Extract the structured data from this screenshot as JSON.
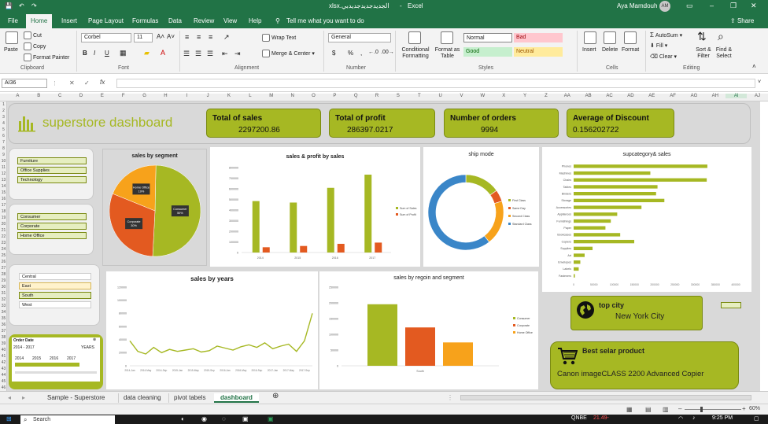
{
  "app": {
    "filename": "الجديدجديدجديدبي.xlsx",
    "app_name": "Excel",
    "user": "Aya Mamdouh",
    "user_initials": "AM"
  },
  "ribbon_tabs": [
    "File",
    "Home",
    "Insert",
    "Page Layout",
    "Formulas",
    "Data",
    "Review",
    "View",
    "Help"
  ],
  "active_tab": "Home",
  "tell_me": "Tell me what you want to do",
  "share_label": "Share",
  "clipboard": {
    "paste": "Paste",
    "cut": "Cut",
    "copy": "Copy",
    "format_painter": "Format Painter",
    "group": "Clipboard"
  },
  "font": {
    "name": "Corbel",
    "size": "11",
    "bold": "B",
    "italic": "I",
    "underline": "U",
    "group": "Font"
  },
  "alignment": {
    "wrap": "Wrap Text",
    "merge": "Merge & Center",
    "group": "Alignment"
  },
  "number": {
    "format": "General",
    "currency": "$",
    "percent": "%",
    "comma": ",",
    "group": "Number"
  },
  "styles": {
    "conditional": "Conditional Formatting",
    "format_table": "Format as Table",
    "normal": "Normal",
    "bad": "Bad",
    "good": "Good",
    "neutral": "Neutral",
    "group": "Styles"
  },
  "cells": {
    "insert": "Insert",
    "delete": "Delete",
    "format": "Format",
    "group": "Cells"
  },
  "editing": {
    "autosum": "AutoSum",
    "fill": "Fill",
    "clear": "Clear",
    "sort": "Sort & Filter",
    "find": "Find & Select",
    "group": "Editing"
  },
  "formula_bar": {
    "name_box": "AI36",
    "fx": "fx",
    "cancel": "✕",
    "enter": "✓"
  },
  "columns": [
    "A",
    "B",
    "C",
    "D",
    "E",
    "F",
    "G",
    "H",
    "I",
    "J",
    "K",
    "L",
    "M",
    "N",
    "O",
    "P",
    "Q",
    "R",
    "S",
    "T",
    "U",
    "V",
    "W",
    "X",
    "Y",
    "Z",
    "AA",
    "AB",
    "AC",
    "AD",
    "AE",
    "AF",
    "AG",
    "AH",
    "AI",
    "AJ"
  ],
  "rows": [
    "1",
    "2",
    "3",
    "4",
    "5",
    "6",
    "7",
    "8",
    "9",
    "10",
    "11",
    "12",
    "13",
    "14",
    "15",
    "16",
    "17",
    "18",
    "19",
    "20",
    "21",
    "22",
    "23",
    "24",
    "25",
    "26",
    "27",
    "28",
    "29",
    "30",
    "31",
    "32",
    "33",
    "34",
    "35",
    "36",
    "37",
    "38",
    "39",
    "40",
    "41",
    "42",
    "43",
    "44",
    "45",
    "46"
  ],
  "dashboard": {
    "title": "superstore  dashboard",
    "kpis": [
      {
        "label": "Total of sales",
        "value": "2297200.86"
      },
      {
        "label": "Total of profit",
        "value": "286397.0217"
      },
      {
        "label": "Number of orders",
        "value": "9994"
      },
      {
        "label": "Average of Discount",
        "value": "0.156202722"
      }
    ],
    "slicer_category": [
      "Furniture",
      "Office Supplies",
      "Technology"
    ],
    "slicer_segment": [
      "Consumer",
      "Corporate",
      "Home Office"
    ],
    "slicer_region": [
      "Central",
      "East",
      "South",
      "West"
    ],
    "timeline": {
      "title": "Order Date",
      "range": "2014 - 2017",
      "level": "YEARS",
      "years": [
        "2014",
        "2015",
        "2016",
        "2017"
      ]
    },
    "top_city": {
      "label": "top city",
      "value": "New York City"
    },
    "best_product": {
      "label": "Best selar product",
      "value": "Canon imageCLASS 2200 Advanced Copier"
    }
  },
  "sheet_tabs": [
    "Sample - Superstore",
    "data cleaning",
    "pivot tabels",
    "dashboard"
  ],
  "active_sheet": "dashboard",
  "status": {
    "zoom": "60%"
  },
  "taskbar": {
    "search": "Search",
    "weather": "QNBE",
    "weather_val": "21.49-",
    "time": "9:25 PM"
  },
  "colors": {
    "excel_green": "#217346",
    "olive": "#a6b823",
    "orange": "#e35a20",
    "yellow": "#f7a21b",
    "blue": "#3a86c8"
  },
  "chart_data": [
    {
      "type": "pie",
      "title": "sales by segment",
      "categories": [
        "Consumer",
        "Corporate",
        "Home Office"
      ],
      "values": [
        50,
        30,
        19
      ],
      "labels": [
        "Consumer 50%",
        "Corporate 30%",
        "Home Office 19%"
      ],
      "colors": [
        "#a6b823",
        "#e35a20",
        "#f7a21b"
      ]
    },
    {
      "type": "bar",
      "title": "sales & profit  by sales",
      "categories": [
        "2014",
        "2015",
        "2016",
        "2017"
      ],
      "series": [
        {
          "name": "Sum of Sales",
          "values": [
            484247,
            470533,
            609206,
            733215
          ],
          "color": "#a6b823"
        },
        {
          "name": "Sum of Profit",
          "values": [
            49544,
            61619,
            81795,
            93439
          ],
          "color": "#e35a20"
        }
      ],
      "ylim": [
        0,
        800000
      ],
      "yticks": [
        "0",
        "100000",
        "200000",
        "300000",
        "400000",
        "500000",
        "600000",
        "700000",
        "800000"
      ]
    },
    {
      "type": "pie",
      "title": "ship mode",
      "donut": true,
      "categories": [
        "First Class",
        "Same Day",
        "Second Class",
        "Standard Class"
      ],
      "values": [
        15,
        5,
        19,
        60
      ],
      "colors": [
        "#a6b823",
        "#e35a20",
        "#f7a21b",
        "#3a86c8"
      ]
    },
    {
      "type": "bar",
      "orientation": "horizontal",
      "title": "supcategory& sales",
      "categories": [
        "Phones",
        "Machines",
        "Chairs",
        "Tables",
        "Binders",
        "Storage",
        "Accessories",
        "Appliances",
        "Furnishings",
        "Paper",
        "Bookcases",
        "Copiers",
        "Supplies",
        "Art",
        "Envelopes",
        "Labels",
        "Fasteners"
      ],
      "values": [
        330007,
        189239,
        328449,
        206966,
        203413,
        223844,
        167380,
        107532,
        91705,
        78479,
        114880,
        149528,
        46674,
        27119,
        16476,
        12486,
        3024
      ],
      "xlim": [
        0,
        400000
      ],
      "xticks": [
        "0",
        "50000",
        "100000",
        "150000",
        "200000",
        "250000",
        "300000",
        "350000",
        "400000"
      ],
      "color": "#a6b823"
    },
    {
      "type": "line",
      "title": "sales by years",
      "x": [
        "2014-Jan",
        "2014-Mar",
        "2014-May",
        "2014-Jul",
        "2014-Sep",
        "2014-Nov",
        "2015-Jan",
        "2015-Mar",
        "2015-May",
        "2015-Jul",
        "2015-Sep",
        "2015-Nov",
        "2016-Jan",
        "2016-Mar",
        "2016-May",
        "2016-Jul",
        "2016-Sep",
        "2016-Nov",
        "2017-Jan",
        "2017-Mar",
        "2017-May",
        "2017-Jul",
        "2017-Sep",
        "2017-Nov"
      ],
      "values": [
        38000,
        22000,
        18000,
        28000,
        20000,
        25000,
        22000,
        24000,
        26000,
        21000,
        23000,
        30000,
        27000,
        24000,
        29000,
        32000,
        28000,
        35000,
        26000,
        30000,
        33000,
        22000,
        38000,
        80000
      ],
      "ylim": [
        0,
        120000
      ],
      "yticks": [
        "0",
        "20000",
        "40000",
        "60000",
        "80000",
        "100000",
        "120000"
      ],
      "color": "#a6b823"
    },
    {
      "type": "bar",
      "title": "sales by regoin and segment",
      "categories": [
        "South"
      ],
      "series": [
        {
          "name": "Consumer",
          "values": [
            195581
          ],
          "color": "#a6b823"
        },
        {
          "name": "Corporate",
          "values": [
            121885
          ],
          "color": "#e35a20"
        },
        {
          "name": "Home Office",
          "values": [
            74255
          ],
          "color": "#f7a21b"
        }
      ],
      "ylim": [
        0,
        250000
      ],
      "yticks": [
        "0",
        "50000",
        "100000",
        "150000",
        "200000",
        "250000"
      ]
    }
  ]
}
